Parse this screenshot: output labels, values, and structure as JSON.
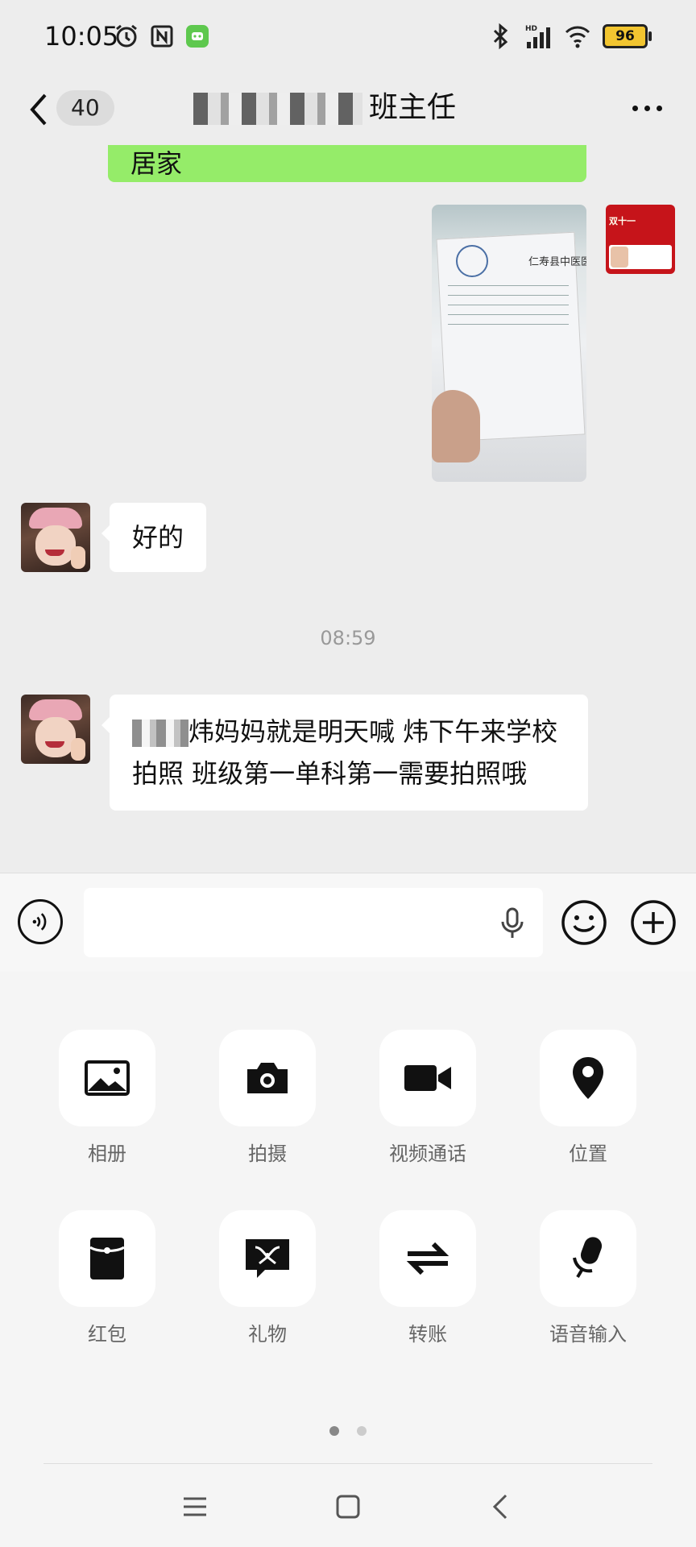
{
  "status_bar": {
    "time": "10:05",
    "battery": "96",
    "network": "HD"
  },
  "header": {
    "unread_count": "40",
    "title_visible": "班主任"
  },
  "messages": {
    "partial_green_text": "居家",
    "reply_1": "好的",
    "timestamp": "08:59",
    "message_2": "炜妈妈就是明天喊 炜下午来学校拍照 班级第一单科第一需要拍照哦"
  },
  "photo": {
    "doc_header": "仁寿县中医医"
  },
  "input": {
    "placeholder": ""
  },
  "panel": {
    "tools": [
      {
        "label": "相册",
        "icon": "image-icon"
      },
      {
        "label": "拍摄",
        "icon": "camera-icon"
      },
      {
        "label": "视频通话",
        "icon": "video-call-icon"
      },
      {
        "label": "位置",
        "icon": "location-icon"
      },
      {
        "label": "红包",
        "icon": "red-packet-icon"
      },
      {
        "label": "礼物",
        "icon": "gift-icon"
      },
      {
        "label": "转账",
        "icon": "transfer-icon"
      },
      {
        "label": "语音输入",
        "icon": "voice-input-icon"
      }
    ]
  },
  "colors": {
    "sent_bubble": "#95ec69",
    "background": "#ededed"
  }
}
